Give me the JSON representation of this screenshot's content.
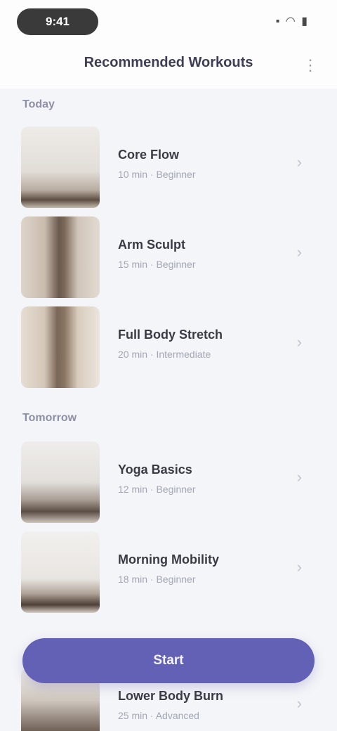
{
  "status_bar": {
    "time": "9:41",
    "icons": "▪ ◠ ▮"
  },
  "nav": {
    "title": "Recommended Workouts",
    "menu_icon": "⋮"
  },
  "sections": [
    {
      "label": "Today",
      "items": [
        {
          "title": "Core Flow",
          "subtitle": "10 min · Beginner",
          "chevron": "›"
        },
        {
          "title": "Arm Sculpt",
          "subtitle": "15 min · Beginner",
          "chevron": "›"
        },
        {
          "title": "Full Body Stretch",
          "subtitle": "20 min · Intermediate",
          "chevron": "›"
        }
      ]
    },
    {
      "label": "Tomorrow",
      "items": [
        {
          "title": "Yoga Basics",
          "subtitle": "12 min · Beginner",
          "chevron": "›"
        },
        {
          "title": "Morning Mobility",
          "subtitle": "18 min · Beginner",
          "chevron": "›"
        },
        {
          "title": "Lower Body Burn",
          "subtitle": "25 min · Advanced",
          "chevron": "›"
        }
      ]
    }
  ],
  "cta": {
    "label": "Start"
  }
}
